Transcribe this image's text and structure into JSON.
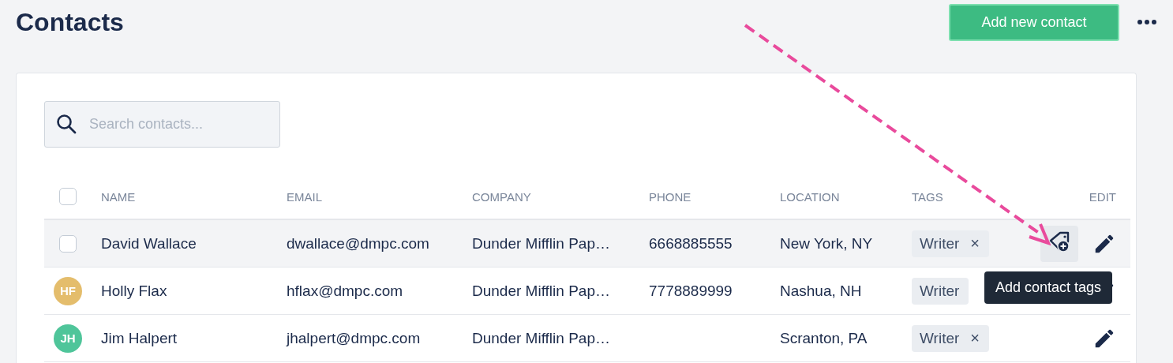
{
  "page": {
    "title": "Contacts",
    "primary_button": "Add new contact"
  },
  "search": {
    "placeholder": "Search contacts..."
  },
  "table": {
    "select_all_checked": false,
    "columns": [
      "NAME",
      "EMAIL",
      "COMPANY",
      "PHONE",
      "LOCATION",
      "TAGS",
      "EDIT"
    ],
    "rows": [
      {
        "hovered": true,
        "checked": false,
        "name": "David Wallace",
        "email": "dwallace@dmpc.com",
        "company": "Dunder Mifflin Pap…",
        "phone": "6668885555",
        "location": "New York, NY",
        "tags": [
          {
            "label": "Writer",
            "remove": "×"
          }
        ]
      },
      {
        "hovered": false,
        "initials": "HF",
        "color": "#e4bd6c",
        "name": "Holly Flax",
        "email": "hflax@dmpc.com",
        "company": "Dunder Mifflin Pap…",
        "phone": "7778889999",
        "location": "Nashua, NH",
        "tags": [
          {
            "label": "Writer"
          }
        ]
      },
      {
        "hovered": false,
        "initials": "JH",
        "color": "#4fc59a",
        "name": "Jim Halpert",
        "email": "jhalpert@dmpc.com",
        "company": "Dunder Mifflin Pap…",
        "location": "Scranton, PA",
        "tags": [
          {
            "label": "Writer",
            "remove": "×"
          }
        ]
      }
    ]
  },
  "tooltip": "Add contact tags"
}
